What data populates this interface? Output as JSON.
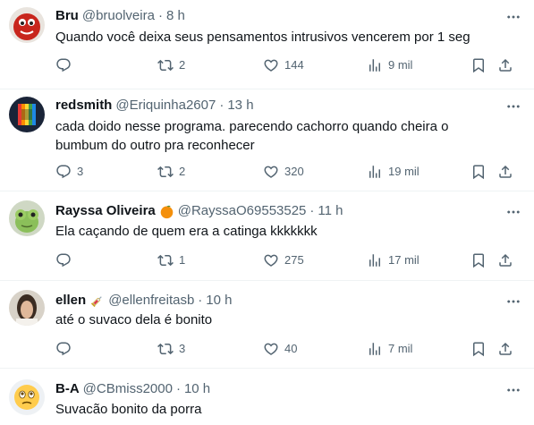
{
  "tweets": [
    {
      "name": "Bru",
      "handle": "@bruolveira",
      "time": "8 h",
      "badge": "",
      "text": "Quando você deixa seus pensamentos intrusivos vencerem por 1 seg",
      "replies": "",
      "retweets": "2",
      "likes": "144",
      "views": "9 mil"
    },
    {
      "name": "redsmith",
      "handle": "@Eriquinha2607",
      "time": "13 h",
      "badge": "",
      "text": "cada doido nesse programa.  parecendo  cachorro quando cheira o bumbum do outro pra reconhecer",
      "replies": "3",
      "retweets": "2",
      "likes": "320",
      "views": "19 mil"
    },
    {
      "name": "Rayssa Oliveira",
      "handle": "@RayssaO69553525",
      "time": "11 h",
      "badge": "orange-emoji",
      "text": "Ela caçando de quem era a catinga kkkkkkk",
      "replies": "",
      "retweets": "1",
      "likes": "275",
      "views": "17 mil"
    },
    {
      "name": "ellen",
      "handle": "@ellenfreitasb",
      "time": "10 h",
      "badge": "syringe-emoji",
      "text": "até o suvaco dela é bonito",
      "replies": "",
      "retweets": "3",
      "likes": "40",
      "views": "7 mil"
    },
    {
      "name": "B-A",
      "handle": "@CBmiss2000",
      "time": "10 h",
      "badge": "",
      "text": "Suvacão bonito da porra",
      "replies": "",
      "retweets": "",
      "likes": "",
      "views": ""
    }
  ],
  "separator": "·",
  "colors": {
    "text": "#0f1419",
    "secondary": "#536471",
    "divider": "#eff3f4"
  },
  "icons": {
    "reply": "reply-icon",
    "retweet": "retweet-icon",
    "like": "like-icon",
    "views": "views-icon",
    "bookmark": "bookmark-icon",
    "share": "share-icon",
    "more": "more-icon"
  }
}
